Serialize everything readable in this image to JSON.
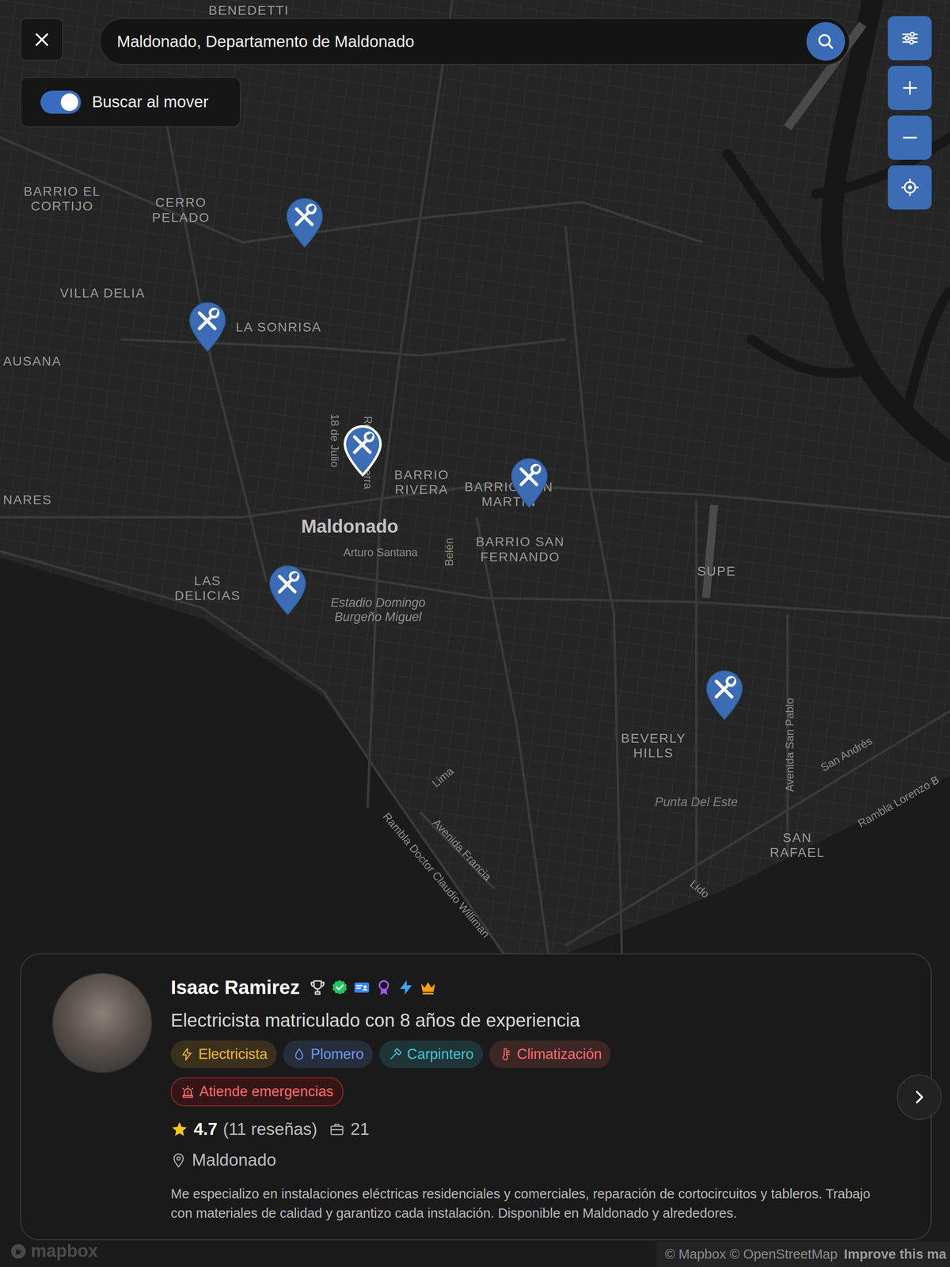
{
  "search": {
    "value": "Maldonado, Departamento de Maldonado"
  },
  "toggle": {
    "label": "Buscar al mover",
    "on": true
  },
  "map": {
    "labels": [
      {
        "text": "BENEDETTI",
        "kind": "area"
      },
      {
        "text": "BARRIO EL CORTIJO",
        "kind": "area"
      },
      {
        "text": "CERRO PELADO",
        "kind": "area"
      },
      {
        "text": "VILLA DELIA",
        "kind": "area"
      },
      {
        "text": "LA SONRISA",
        "kind": "area"
      },
      {
        "text": "AUSANA",
        "kind": "area"
      },
      {
        "text": "NARES",
        "kind": "area"
      },
      {
        "text": "18 de Julio",
        "kind": "street"
      },
      {
        "text": "Román Guerra",
        "kind": "street"
      },
      {
        "text": "BARRIO RIVERA",
        "kind": "area"
      },
      {
        "text": "BARRIO SAN MARTÍN",
        "kind": "area"
      },
      {
        "text": "Maldonado",
        "kind": "city"
      },
      {
        "text": "Arturo Santana",
        "kind": "street"
      },
      {
        "text": "Belén",
        "kind": "street"
      },
      {
        "text": "BARRIO SAN FERNANDO",
        "kind": "area"
      },
      {
        "text": "LAS DELICIAS",
        "kind": "area"
      },
      {
        "text": "Estadio Domingo Burgeño Miguel",
        "kind": "poi"
      },
      {
        "text": "SUPE",
        "kind": "area"
      },
      {
        "text": "BEVERLY HILLS",
        "kind": "area"
      },
      {
        "text": "Punta Del Este",
        "kind": "place"
      },
      {
        "text": "Avenida San Pablo",
        "kind": "street"
      },
      {
        "text": "San Andrés",
        "kind": "street"
      },
      {
        "text": "Rambla Lorenzo B",
        "kind": "street"
      },
      {
        "text": "SAN RAFAEL",
        "kind": "area"
      },
      {
        "text": "Lido",
        "kind": "street"
      },
      {
        "text": "Lima",
        "kind": "street"
      },
      {
        "text": "Avenida Francia",
        "kind": "street"
      },
      {
        "text": "Rambla Doctor Claudio Williman",
        "kind": "street"
      }
    ],
    "pins": [
      {
        "selected": false
      },
      {
        "selected": false
      },
      {
        "selected": true
      },
      {
        "selected": false
      },
      {
        "selected": false
      },
      {
        "selected": false
      }
    ]
  },
  "card": {
    "name": "Isaac Ramirez",
    "headline": "Electricista matriculado con 8 años de experiencia",
    "tags": [
      {
        "label": "Electricista",
        "color": "#f2b52e"
      },
      {
        "label": "Plomero",
        "color": "#6b9cf5"
      },
      {
        "label": "Carpintero",
        "color": "#3fc7d6"
      },
      {
        "label": "Climatización",
        "color": "#ff6b6b"
      }
    ],
    "emergency": "Atiende emergencias",
    "rating": "4.7",
    "reviews": "(11 reseñas)",
    "jobs": "21",
    "location": "Maldonado",
    "description": "Me especializo en instalaciones eléctricas residenciales y comerciales, reparación de cortocircuitos y tableros. Trabajo con materiales de calidad y garantizo cada instalación. Disponible en Maldonado y alrededores."
  },
  "attribution": {
    "logo": "mapbox",
    "text": "© Mapbox © OpenStreetMap",
    "link": "Improve this ma"
  }
}
